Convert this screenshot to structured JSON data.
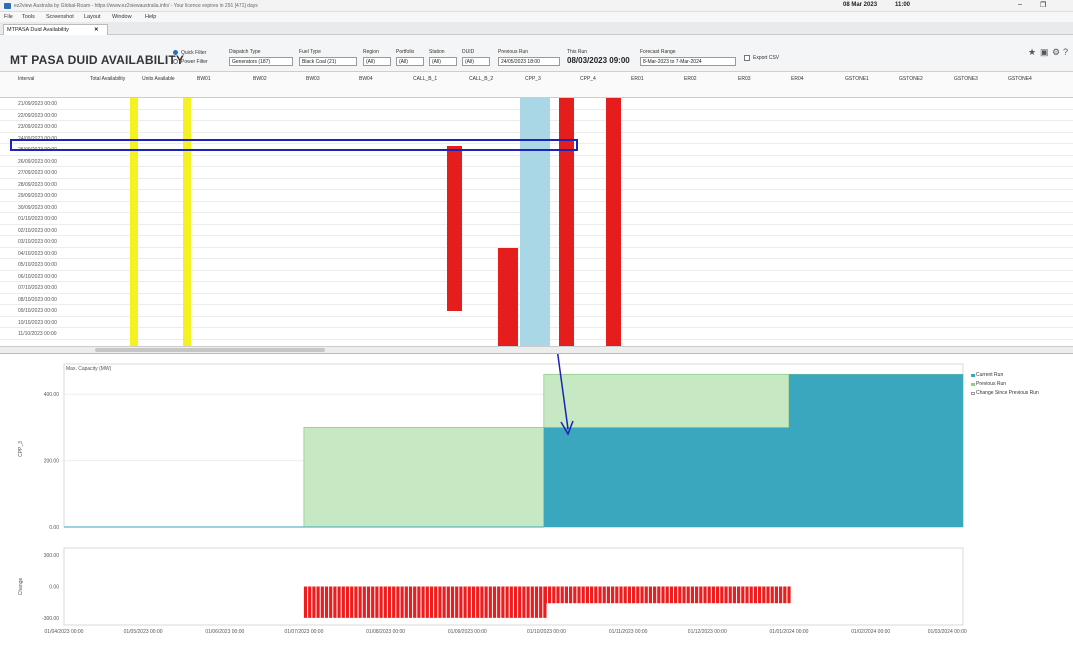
{
  "window": {
    "title": "ez2view Australia by Global-Roam - https://www.ez2viewaustralia.info/ - Your licence expires in 291 [471] days",
    "date": "08 Mar 2023",
    "time": "11:00"
  },
  "menu": [
    "File",
    "Tools",
    "Screenshot",
    "Layout",
    "Window",
    "Help"
  ],
  "tab": {
    "label": "MTPASA Duid Availability"
  },
  "page": {
    "title": "MT PASA DUID AVAILABILITY"
  },
  "toolbar": {
    "quick_filter": "Quick Filter",
    "power_filter": "Power Filter",
    "filters": [
      {
        "label": "Dispatch Type",
        "value": "Generators (187)"
      },
      {
        "label": "Fuel Type",
        "value": "Black Coal (21)"
      },
      {
        "label": "Region",
        "value": "(All)"
      },
      {
        "label": "Portfolio",
        "value": "(All)"
      },
      {
        "label": "Station",
        "value": "(All)"
      },
      {
        "label": "DUID",
        "value": "(All)"
      }
    ],
    "previous_run": {
      "label": "Previous Run",
      "value": "24/05/2023 18:00"
    },
    "this_run": {
      "label": "This Run",
      "value": "08/03/2023 09:00"
    },
    "forecast_range": {
      "label": "Forecast Range",
      "value": "8-Mar-2023 to 7-Mar-2024"
    },
    "export": "Export CSV"
  },
  "grid": {
    "columns": [
      "Interval",
      "Total Availability",
      "Units Available",
      "BW01",
      "BW02",
      "BW03",
      "BW04",
      "CALL_B_1",
      "CALL_B_2",
      "CPP_3",
      "CPP_4",
      "ER01",
      "ER02",
      "ER03",
      "ER04",
      "GSTONE1",
      "GSTONE2",
      "GSTONE3",
      "GSTONE4"
    ],
    "rows": [
      "21/09/2023 00:00",
      "22/09/2023 00:00",
      "23/09/2023 00:00",
      "24/09/2023 00:00",
      "25/09/2023 00:00",
      "26/09/2023 00:00",
      "27/09/2023 00:00",
      "28/09/2023 00:00",
      "29/09/2023 00:00",
      "30/09/2023 00:00",
      "01/10/2023 00:00",
      "02/10/2023 00:00",
      "03/10/2023 00:00",
      "04/10/2023 00:00",
      "05/10/2023 00:00",
      "06/10/2023 00:00",
      "07/10/2023 00:00",
      "08/10/2023 00:00",
      "09/10/2023 00:00",
      "10/10/2023 00:00",
      "11/10/2023 00:00"
    ]
  },
  "chart_data": {
    "type": "area",
    "title": "Max. Capacity (MW)",
    "ylabel": "CPP_3",
    "ylim": [
      0,
      470
    ],
    "yticks": [
      "400.00",
      "200.00",
      "0.00"
    ],
    "x": [
      "01/04/2023 00:00",
      "01/05/2023 00:00",
      "01/06/2023 00:00",
      "01/07/2023 00:00",
      "01/08/2023 00:00",
      "01/09/2023 00:00",
      "01/10/2023 00:00",
      "01/11/2023 00:00",
      "01/12/2023 00:00",
      "01/01/2024 00:00",
      "01/02/2024 00:00",
      "01/03/2024 00:00"
    ],
    "series": [
      {
        "name": "Current Run",
        "color": "#3ba7bf",
        "segments": [
          {
            "from": "2023-04-01",
            "to": "2023-09-30",
            "value": 0
          },
          {
            "from": "2023-09-30",
            "to": "2024-03-07",
            "value": 300
          }
        ]
      },
      {
        "name": "Previous Run",
        "color": "#c6e8c2",
        "segments": [
          {
            "from": "2023-04-01",
            "to": "2023-07-01",
            "value": 0
          },
          {
            "from": "2023-07-01",
            "to": "2023-09-30",
            "value": 300
          },
          {
            "from": "2023-09-30",
            "to": "2024-01-01",
            "value": 460
          },
          {
            "from": "2024-01-01",
            "to": "2024-03-07",
            "value": 460
          }
        ]
      },
      {
        "name": "Change Since Previous Run"
      }
    ],
    "change": {
      "ylabel": "Change",
      "yticks": [
        "300.00",
        "0.00",
        "-300.00"
      ],
      "ylim": [
        -330,
        330
      ],
      "segments": [
        {
          "from": "2023-07-01",
          "to": "2023-09-30",
          "value": -300
        },
        {
          "from": "2023-09-30",
          "to": "2024-01-01",
          "value": -160
        }
      ]
    }
  },
  "legend": [
    "Current Run",
    "Previous Run",
    "Change Since Previous Run"
  ]
}
